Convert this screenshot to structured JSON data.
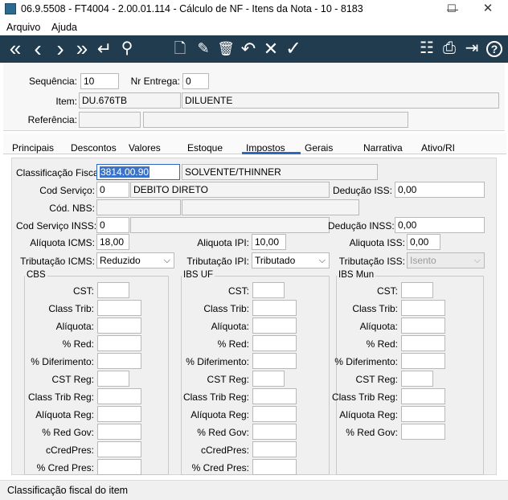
{
  "window": {
    "title": "06.9.5508 - FT4004 - 2.00.01.114 - Cálculo de NF - Itens da Nota - 10 - 8183",
    "minimize": "—",
    "maximize": "☐",
    "close": "✕"
  },
  "menu": {
    "file": "Arquivo",
    "help": "Ajuda"
  },
  "toolbar": {
    "first": "«",
    "prev": "‹",
    "next": "›",
    "last": "»",
    "enter": "↵",
    "search": "⚲",
    "new": "🗋",
    "edit": "✎",
    "delete": "🗑",
    "undo": "↶",
    "cancel": "✕",
    "confirm": "✓",
    "tree": "☷",
    "print": "⎙",
    "exit": "⇥",
    "help": "?"
  },
  "header": {
    "sequence_label": "Sequência:",
    "sequence_value": "10",
    "delivery_label": "Nr Entrega:",
    "delivery_value": "0",
    "item_label": "Item:",
    "item_code": "DU.676TB",
    "item_desc": "DILUENTE",
    "reference_label": "Referência:",
    "reference_value": "",
    "reference_desc": ""
  },
  "tabs": [
    "Principais",
    "Descontos",
    "Valores",
    "Estoque",
    "Impostos",
    "Gerais",
    "Narrativa",
    "Ativo/RI"
  ],
  "active_tab": "Impostos",
  "taxes": {
    "fiscal_class_label": "Classificação Fiscal:",
    "fiscal_class_code": "3814.00.90",
    "fiscal_class_desc": "SOLVENTE/THINNER",
    "service_code_label": "Cod Serviço:",
    "service_code_value": "0",
    "service_code_desc": "DEBITO DIRETO",
    "iss_deduction_label": "Dedução ISS:",
    "iss_deduction_value": "0,00",
    "nbs_label": "Cód. NBS:",
    "nbs_value": "",
    "nbs_desc": "",
    "inss_service_label": "Cod Serviço INSS:",
    "inss_service_value": "0",
    "inss_service_desc": "",
    "inss_deduction_label": "Dedução INSS:",
    "inss_deduction_value": "0,00",
    "icms_rate_label": "Alíquota ICMS:",
    "icms_rate_value": "18,00",
    "ipi_rate_label": "Aliquota IPI:",
    "ipi_rate_value": "10,00",
    "iss_rate_label": "Aliquota ISS:",
    "iss_rate_value": "0,00",
    "icms_taxation_label": "Tributação ICMS:",
    "icms_taxation_value": "Reduzido",
    "ipi_taxation_label": "Tributação IPI:",
    "ipi_taxation_value": "Tributado",
    "iss_taxation_label": "Tributação ISS:",
    "iss_taxation_value": "Isento"
  },
  "groups": {
    "cbs": {
      "title": "CBS",
      "labels": [
        "CST:",
        "Class Trib:",
        "Alíquota:",
        "% Red:",
        "% Diferimento:",
        "CST Reg:",
        "Class Trib Reg:",
        "Alíquota Reg:",
        "% Red Gov:",
        "cCredPres:",
        "% Cred Pres:"
      ]
    },
    "ibs_uf": {
      "title": "IBS UF",
      "labels": [
        "CST:",
        "Class Trib:",
        "Alíquota:",
        "% Red:",
        "% Diferimento:",
        "CST Reg:",
        "Class Trib Reg:",
        "Alíquota Reg:",
        "% Red Gov:",
        "cCredPres:",
        "% Cred Pres:"
      ]
    },
    "ibs_mun": {
      "title": "IBS Mun",
      "labels": [
        "CST:",
        "Class Trib:",
        "Alíquota:",
        "% Red:",
        "% Diferimento:",
        "CST Reg:",
        "Class Trib Reg:",
        "Alíquota Reg:",
        "% Red Gov:"
      ]
    }
  },
  "status": {
    "text": "Classificação fiscal do item"
  },
  "colors": {
    "toolbar_bg": "#213b4f",
    "accent": "#2a68c4"
  }
}
